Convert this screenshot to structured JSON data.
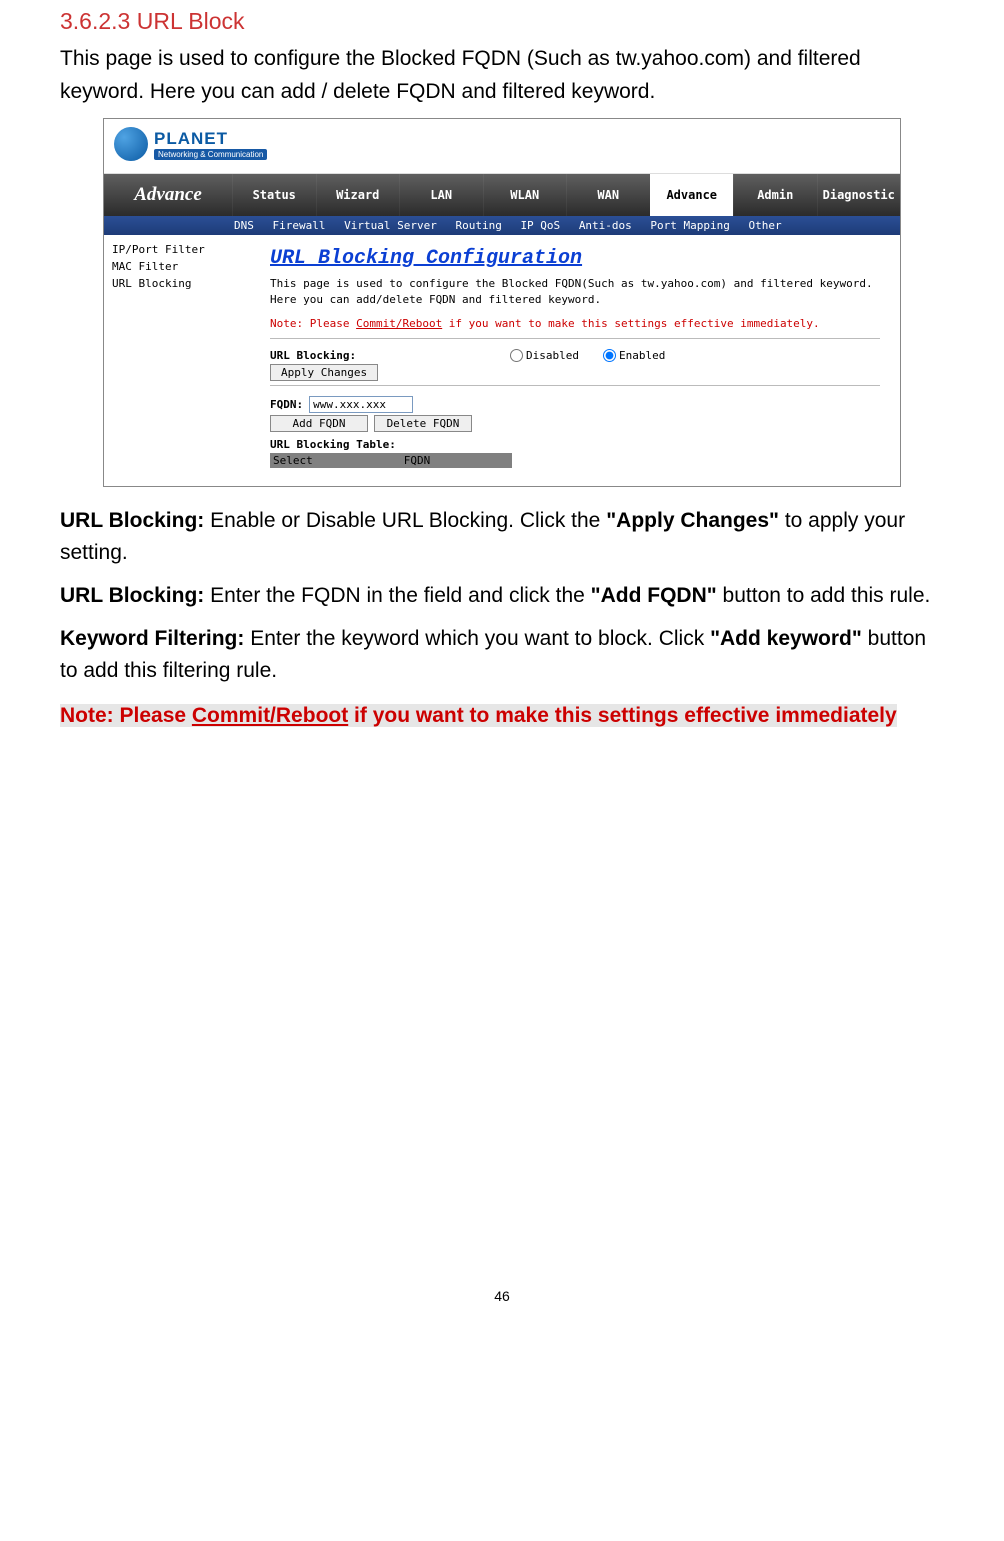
{
  "doc": {
    "heading": "3.6.2.3 URL Block",
    "intro": "This page is used to configure the Blocked FQDN (Such as tw.yahoo.com) and filtered keyword. Here you can add / delete FQDN and filtered keyword.",
    "p1_label": "URL Blocking: ",
    "p1_text": "Enable or Disable URL Blocking. Click the ",
    "p1_bold": "\"Apply Changes\"",
    "p1_tail": " to apply your setting.",
    "p2_label": "URL Blocking: ",
    "p2_text": "Enter the FQDN in the field and click the ",
    "p2_bold": "\"Add FQDN\"",
    "p2_tail": " button to add this rule.",
    "p3_label": "Keyword Filtering: ",
    "p3_text": "Enter the keyword which you want to block. Click ",
    "p3_bold": "\"Add keyword\"",
    "p3_tail": " button to add this filtering rule.",
    "note_pre": "Note: Please ",
    "note_link": "Commit/Reboot",
    "note_post": " if you want to make this settings effective immediately",
    "page_number": "46"
  },
  "ui": {
    "brand": "PLANET",
    "brand_sub": "Networking & Communication",
    "nav_brand": "Advance",
    "nav": [
      "Status",
      "Wizard",
      "LAN",
      "WLAN",
      "WAN",
      "Advance",
      "Admin",
      "Diagnostic"
    ],
    "nav_active_index": 5,
    "subnav": [
      "DNS",
      "Firewall",
      "Virtual Server",
      "Routing",
      "IP QoS",
      "Anti-dos",
      "Port Mapping",
      "Other"
    ],
    "sidebar": [
      "IP/Port Filter",
      "MAC Filter",
      "URL Blocking"
    ],
    "title": "URL Blocking Configuration",
    "desc": "This page is used to configure the Blocked FQDN(Such as tw.yahoo.com) and filtered keyword. Here you can add/delete FQDN and filtered keyword.",
    "note_pre": "Note: Please ",
    "note_link": "Commit/Reboot",
    "note_post": " if you want to make this settings effective immediately.",
    "url_blocking_label": "URL Blocking:",
    "disabled": "Disabled",
    "enabled": "Enabled",
    "selected": "enabled",
    "apply": "Apply Changes",
    "fqdn_label": "FQDN:",
    "fqdn_value": "www.xxx.xxx",
    "add_fqdn": "Add FQDN",
    "delete_fqdn": "Delete FQDN",
    "table_title": "URL Blocking Table:",
    "col_select": "Select",
    "col_fqdn": "FQDN"
  }
}
